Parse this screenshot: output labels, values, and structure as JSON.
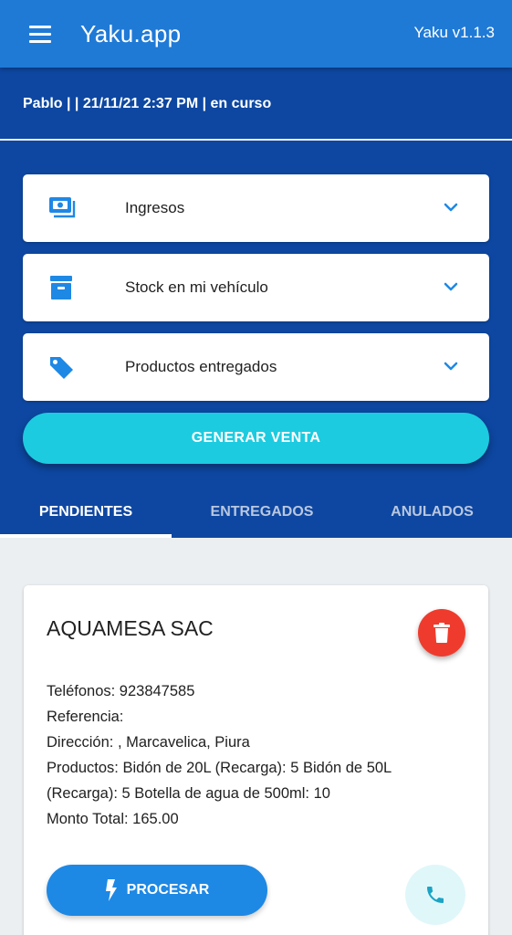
{
  "appbar": {
    "title": "Yaku.app",
    "version": "Yaku v1.1.3"
  },
  "session": {
    "info": "Pablo | | 21/11/21 2:37 PM | en curso"
  },
  "accordion": [
    {
      "label": "Ingresos",
      "icon": "money-icon"
    },
    {
      "label": "Stock en mi vehículo",
      "icon": "archive-box-icon"
    },
    {
      "label": "Productos entregados",
      "icon": "tag-icon"
    }
  ],
  "generate_button": "GENERAR VENTA",
  "tabs": [
    {
      "label": "PENDIENTES",
      "active": true
    },
    {
      "label": "ENTREGADOS",
      "active": false
    },
    {
      "label": "ANULADOS",
      "active": false
    }
  ],
  "order": {
    "client": "AQUAMESA SAC",
    "phones": "Teléfonos: 923847585",
    "reference": "Referencia:",
    "address": "Dirección: , Marcavelica, Piura",
    "products": "Productos: Bidón de 20L (Recarga): 5 Bidón de 50L (Recarga): 5 Botella de agua de 500ml: 10",
    "total": "Monto Total: 165.00",
    "process_label": "PROCESAR"
  },
  "colors": {
    "appbar": "#1f7ad6",
    "panel": "#0d47a1",
    "accent_cyan": "#1ccbe0",
    "primary_button": "#1e88e5",
    "danger": "#ef3b2d",
    "icon_blue": "#1e88e5"
  }
}
